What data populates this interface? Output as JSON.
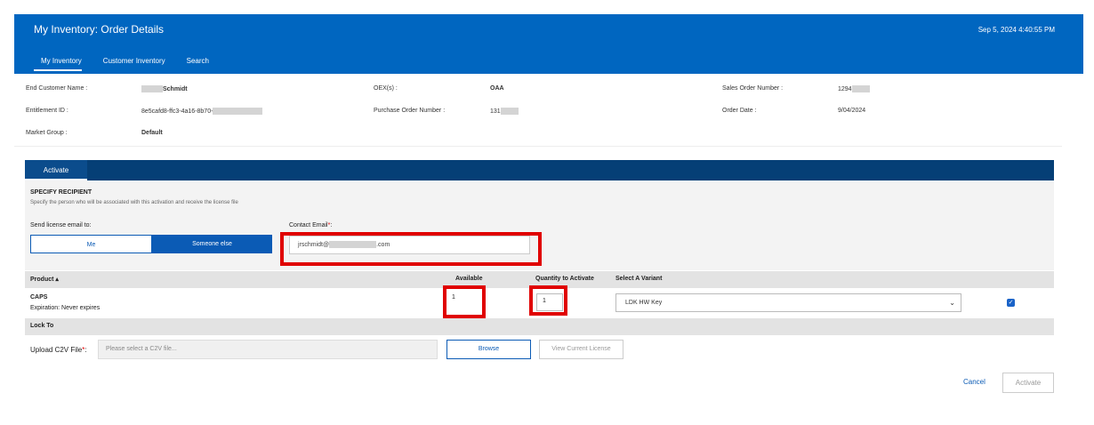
{
  "header": {
    "title": "My Inventory: Order Details",
    "datetime": "Sep 5, 2024 4:40:55 PM",
    "tabs": [
      {
        "label": "My Inventory"
      },
      {
        "label": "Customer Inventory"
      },
      {
        "label": "Search"
      }
    ]
  },
  "order": {
    "end_customer_label": "End Customer Name :",
    "end_customer_value": "Schmidt",
    "entitlement_label": "Entitlement ID :",
    "entitlement_value": "8e5cafd8-ffc3-4a16-8b70-",
    "market_group_label": "Market Group :",
    "market_group_value": "Default",
    "oex_label": "OEX(s) :",
    "oex_value": "OAA",
    "po_label": "Purchase Order Number :",
    "po_value": "131",
    "sales_order_label": "Sales Order Number :",
    "sales_order_value": "1294",
    "order_date_label": "Order Date :",
    "order_date_value": "9/04/2024"
  },
  "panel": {
    "tab_label": "Activate"
  },
  "recipient": {
    "heading": "SPECIFY RECIPIENT",
    "description": "Specify the person who will be associated with this activation and receive the license file",
    "send_label": "Send license email to:",
    "toggle_me": "Me",
    "toggle_else": "Someone else",
    "contact_label": "Contact Email",
    "required_mark": "*",
    "colon": ":",
    "email_prefix": "jrschmidt@",
    "email_suffix": ".com"
  },
  "table": {
    "columns": {
      "product": "Product ▴",
      "available": "Available",
      "quantity": "Quantity to Activate",
      "variant": "Select A Variant"
    },
    "row": {
      "product": "CAPS",
      "expiration": "Expiration: Never expires",
      "available": "1",
      "quantity": "1",
      "variant": "LDK HW Key",
      "checked_mark": "✓"
    }
  },
  "lock": {
    "heading": "Lock To",
    "upload_label": "Upload C2V File",
    "placeholder": "Please select a C2V file...",
    "browse": "Browse",
    "view_license": "View Current License"
  },
  "footer": {
    "cancel": "Cancel",
    "activate": "Activate"
  },
  "colors": {
    "header_blue": "#0066c0",
    "panel_navy": "#053f76",
    "highlight_red": "#e00000"
  }
}
